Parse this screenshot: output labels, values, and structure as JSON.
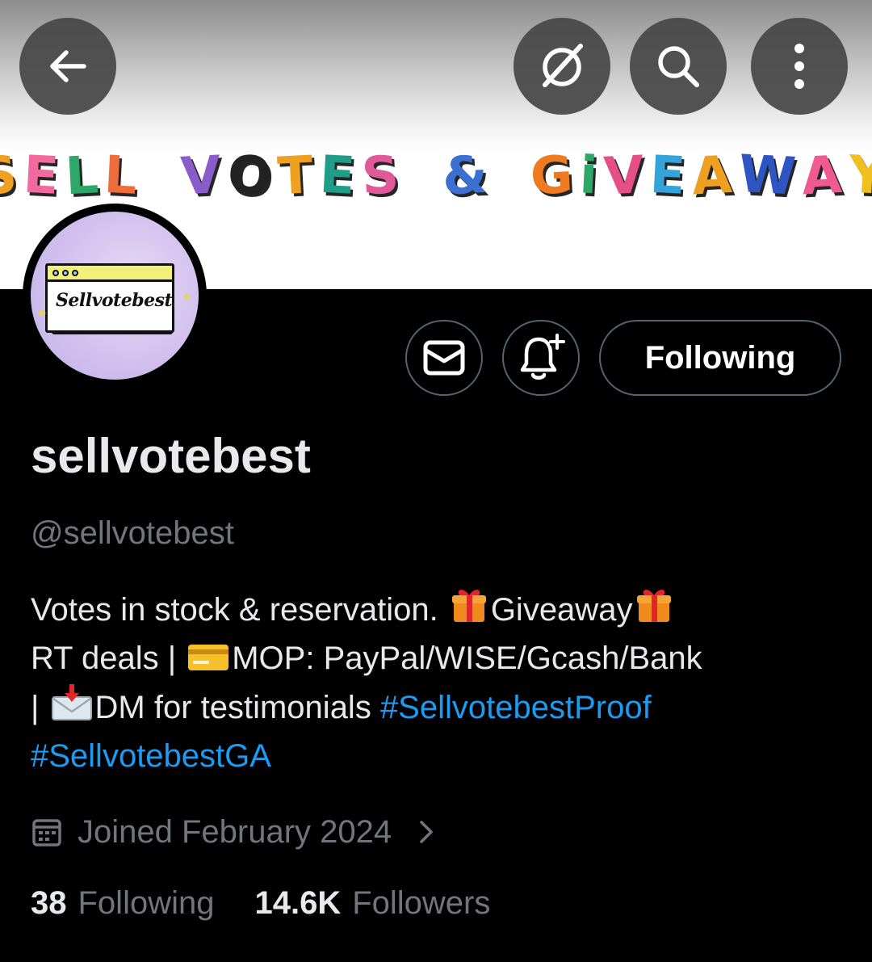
{
  "banner": {
    "title_words": [
      {
        "text": "SELL",
        "colors": [
          "#f0a020",
          "#f06aa0",
          "#2ea86a",
          "#ef6d3c"
        ]
      },
      {
        "text": "VOTES",
        "colors": [
          "#8a5cc9",
          "#222222",
          "#f0a020",
          "#1f9d88",
          "#e05a9a"
        ]
      },
      {
        "text": "&",
        "colors": [
          "#3b6fd1"
        ]
      },
      {
        "text": "GiVEAWAY",
        "colors": [
          "#f07a20",
          "#2ea86a",
          "#e64f86",
          "#33a3d9",
          "#f0a020",
          "#2f55c4",
          "#ef5b8f",
          "#f0c020"
        ]
      }
    ]
  },
  "header": {
    "back_icon": "arrow-left-icon",
    "grok_icon": "grok-slash-circle-icon",
    "search_icon": "search-icon",
    "more_icon": "more-vertical-icon"
  },
  "avatar": {
    "text": "Sellvotebest"
  },
  "actions": {
    "message_icon": "envelope-icon",
    "notify_icon": "bell-plus-icon",
    "following_label": "Following"
  },
  "profile": {
    "name": "sellvotebest",
    "handle": "@sellvotebest",
    "bio": {
      "line1_text": "Votes in stock & reservation. ",
      "line1_after_gift": "Giveaway",
      "line2_text_a": "RT deals | ",
      "line2_text_b": "MOP: PayPal/WISE/Gcash/Bank",
      "line3_text_a": "| ",
      "line3_text_b": "DM for testimonials ",
      "hashtag1": "#SellvotebestProof",
      "hashtag2": "#SellvotebestGA"
    },
    "joined": "Joined February 2024",
    "calendar_icon": "calendar-icon",
    "chevron_icon": "chevron-right-icon"
  },
  "stats": {
    "following_count": "38",
    "following_label": "Following",
    "followers_count": "14.6K",
    "followers_label": "Followers"
  },
  "colors": {
    "background": "#000000",
    "text": "#e7e9ea",
    "muted": "#71767b",
    "link": "#1d9bf0",
    "button_border": "#536471"
  }
}
